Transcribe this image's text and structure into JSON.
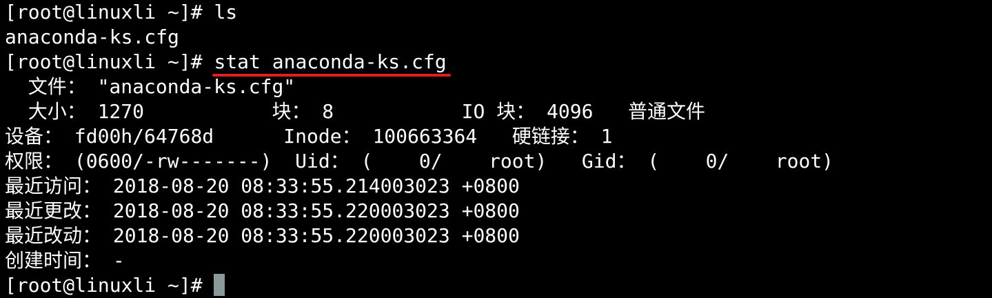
{
  "terminal": {
    "prompt": "[root@linuxli ~]# ",
    "lines": [
      {
        "type": "command",
        "prompt": "[root@linuxli ~]# ",
        "command": "ls"
      },
      {
        "type": "output",
        "text": "anaconda-ks.cfg"
      },
      {
        "type": "command",
        "prompt": "[root@linuxli ~]# ",
        "command": "stat anaconda-ks.cfg"
      },
      {
        "type": "output",
        "label": "  文件：",
        "text": " \"anaconda-ks.cfg\""
      },
      {
        "type": "output",
        "label": "  大小：",
        "text": " 1270           块： 8           IO 块： 4096   普通文件"
      },
      {
        "type": "output",
        "label": "设备：",
        "text": " fd00h/64768d      Inode： 100663364   硬链接： 1"
      },
      {
        "type": "output",
        "label": "权限：",
        "text": " (0600/-rw-------)  Uid： (    0/    root)   Gid： (    0/    root)"
      },
      {
        "type": "output",
        "label": "最近访问：",
        "text": " 2018-08-20 08:33:55.214003023 +0800"
      },
      {
        "type": "output",
        "label": "最近更改：",
        "text": " 2018-08-20 08:33:55.220003023 +0800"
      },
      {
        "type": "output",
        "label": "最近改动：",
        "text": " 2018-08-20 08:33:55.220003023 +0800"
      },
      {
        "type": "output",
        "label": "创建时间：",
        "text": " -"
      },
      {
        "type": "prompt",
        "prompt": "[root@linuxli ~]# "
      }
    ]
  },
  "colors": {
    "background": "#000000",
    "foreground": "#ffffff",
    "underline": "#e41d1d",
    "cursor": "#8a9a9a"
  }
}
